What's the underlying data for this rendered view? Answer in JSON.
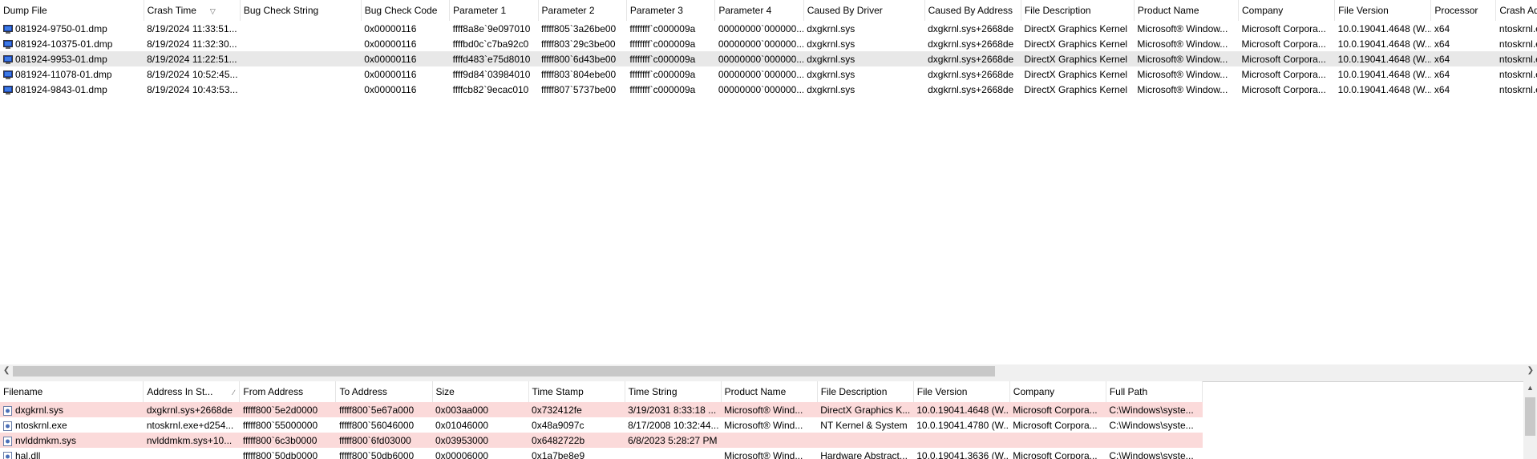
{
  "crash_list": {
    "columns": [
      "Dump File",
      "Crash Time",
      "Bug Check String",
      "Bug Check Code",
      "Parameter 1",
      "Parameter 2",
      "Parameter 3",
      "Parameter 4",
      "Caused By Driver",
      "Caused By Address",
      "File Description",
      "Product Name",
      "Company",
      "File Version",
      "Processor",
      "Crash Address"
    ],
    "rows": [
      [
        "081924-9750-01.dmp",
        "8/19/2024 11:33:51...",
        "",
        "0x00000116",
        "ffff8a8e`9e097010",
        "fffff805`3a26be00",
        "ffffffff`c000009a",
        "00000000`000000...",
        "dxgkrnl.sys",
        "dxgkrnl.sys+2668de",
        "DirectX Graphics Kernel",
        "Microsoft® Window...",
        "Microsoft Corpora...",
        "10.0.19041.4648 (W...",
        "x64",
        "ntoskrnl.exe"
      ],
      [
        "081924-10375-01.dmp",
        "8/19/2024 11:32:30...",
        "",
        "0x00000116",
        "ffffbd0c`c7ba92c0",
        "fffff803`29c3be00",
        "ffffffff`c000009a",
        "00000000`000000...",
        "dxgkrnl.sys",
        "dxgkrnl.sys+2668de",
        "DirectX Graphics Kernel",
        "Microsoft® Window...",
        "Microsoft Corpora...",
        "10.0.19041.4648 (W...",
        "x64",
        "ntoskrnl.exe"
      ],
      [
        "081924-9953-01.dmp",
        "8/19/2024 11:22:51...",
        "",
        "0x00000116",
        "ffffd483`e75d8010",
        "fffff800`6d43be00",
        "ffffffff`c000009a",
        "00000000`000000...",
        "dxgkrnl.sys",
        "dxgkrnl.sys+2668de",
        "DirectX Graphics Kernel",
        "Microsoft® Window...",
        "Microsoft Corpora...",
        "10.0.19041.4648 (W...",
        "x64",
        "ntoskrnl.exe"
      ],
      [
        "081924-11078-01.dmp",
        "8/19/2024 10:52:45...",
        "",
        "0x00000116",
        "ffff9d84`03984010",
        "fffff803`804ebe00",
        "ffffffff`c000009a",
        "00000000`000000...",
        "dxgkrnl.sys",
        "dxgkrnl.sys+2668de",
        "DirectX Graphics Kernel",
        "Microsoft® Window...",
        "Microsoft Corpora...",
        "10.0.19041.4648 (W...",
        "x64",
        "ntoskrnl.exe"
      ],
      [
        "081924-9843-01.dmp",
        "8/19/2024 10:43:53...",
        "",
        "0x00000116",
        "ffffcb82`9ecac010",
        "fffff807`5737be00",
        "ffffffff`c000009a",
        "00000000`000000...",
        "dxgkrnl.sys",
        "dxgkrnl.sys+2668de",
        "DirectX Graphics Kernel",
        "Microsoft® Window...",
        "Microsoft Corpora...",
        "10.0.19041.4648 (W...",
        "x64",
        "ntoskrnl.exe"
      ]
    ],
    "selected_index": 2
  },
  "driver_list": {
    "columns": [
      "Filename",
      "Address In St...",
      "From Address",
      "To Address",
      "Size",
      "Time Stamp",
      "Time String",
      "Product Name",
      "File Description",
      "File Version",
      "Company",
      "Full Path"
    ],
    "rows": [
      {
        "cells": [
          "dxgkrnl.sys",
          "dxgkrnl.sys+2668de",
          "fffff800`5e2d0000",
          "fffff800`5e67a000",
          "0x003aa000",
          "0x732412fe",
          "3/19/2031 8:33:18 ...",
          "Microsoft® Wind...",
          "DirectX Graphics K...",
          "10.0.19041.4648 (W...",
          "Microsoft Corpora...",
          "C:\\Windows\\syste..."
        ],
        "highlight": true
      },
      {
        "cells": [
          "ntoskrnl.exe",
          "ntoskrnl.exe+d254...",
          "fffff800`55000000",
          "fffff800`56046000",
          "0x01046000",
          "0x48a9097c",
          "8/17/2008 10:32:44...",
          "Microsoft® Wind...",
          "NT Kernel & System",
          "10.0.19041.4780 (W...",
          "Microsoft Corpora...",
          "C:\\Windows\\syste..."
        ],
        "highlight": false
      },
      {
        "cells": [
          "nvlddmkm.sys",
          "nvlddmkm.sys+10...",
          "fffff800`6c3b0000",
          "fffff800`6fd03000",
          "0x03953000",
          "0x6482722b",
          "6/8/2023 5:28:27 PM",
          "",
          "",
          "",
          "",
          ""
        ],
        "highlight": true
      },
      {
        "cells": [
          "hal.dll",
          "",
          "fffff800`50db0000",
          "fffff800`50db6000",
          "0x00006000",
          "0x1a7be8e9",
          "",
          "Microsoft® Wind...",
          "Hardware Abstract...",
          "10.0.19041.3636 (W...",
          "Microsoft Corpora...",
          "C:\\Windows\\syste..."
        ],
        "highlight": false
      }
    ]
  }
}
